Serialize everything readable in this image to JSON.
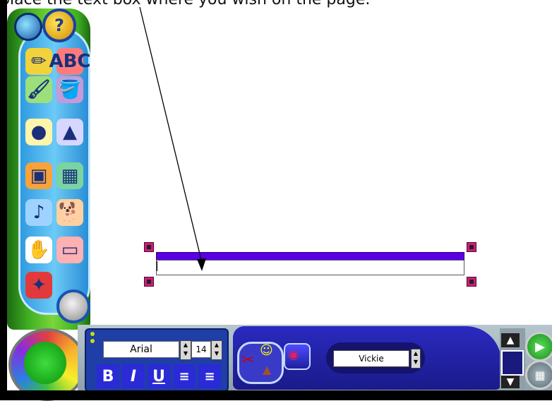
{
  "caption": "place the text box where you wish on the page.",
  "left_panel": {
    "help_label": "?",
    "tools": [
      {
        "name": "pencil-crayon-tool",
        "glyph": "✏"
      },
      {
        "name": "text-tool",
        "glyph": "ABC"
      },
      {
        "name": "brush-tool",
        "glyph": "🖌"
      },
      {
        "name": "paint-bucket-tool",
        "glyph": "🪣"
      },
      {
        "name": "sticker-roll-tool",
        "glyph": "●"
      },
      {
        "name": "stamp-tool",
        "glyph": "▲"
      },
      {
        "name": "paint-can-tool",
        "glyph": "▣"
      },
      {
        "name": "picture-tool",
        "glyph": "▦"
      },
      {
        "name": "sound-tool",
        "glyph": "♪"
      },
      {
        "name": "animal-tool",
        "glyph": "🐕"
      },
      {
        "name": "hand-tool",
        "glyph": "✋"
      },
      {
        "name": "eraser-tool",
        "glyph": "▭"
      },
      {
        "name": "firecracker-tool",
        "glyph": "✦"
      }
    ]
  },
  "text_toolbar": {
    "font": "Arial",
    "size": "14",
    "bold_label": "B",
    "italic_label": "I",
    "underline_label": "U",
    "align_left_label": "≡",
    "align_center_label": "≡",
    "align_right_label": "≡"
  },
  "sound_toolbar": {
    "voice": "Vickie"
  },
  "colors": {
    "textbox_bar": "#5a00e6",
    "handle": "#c8207a"
  }
}
